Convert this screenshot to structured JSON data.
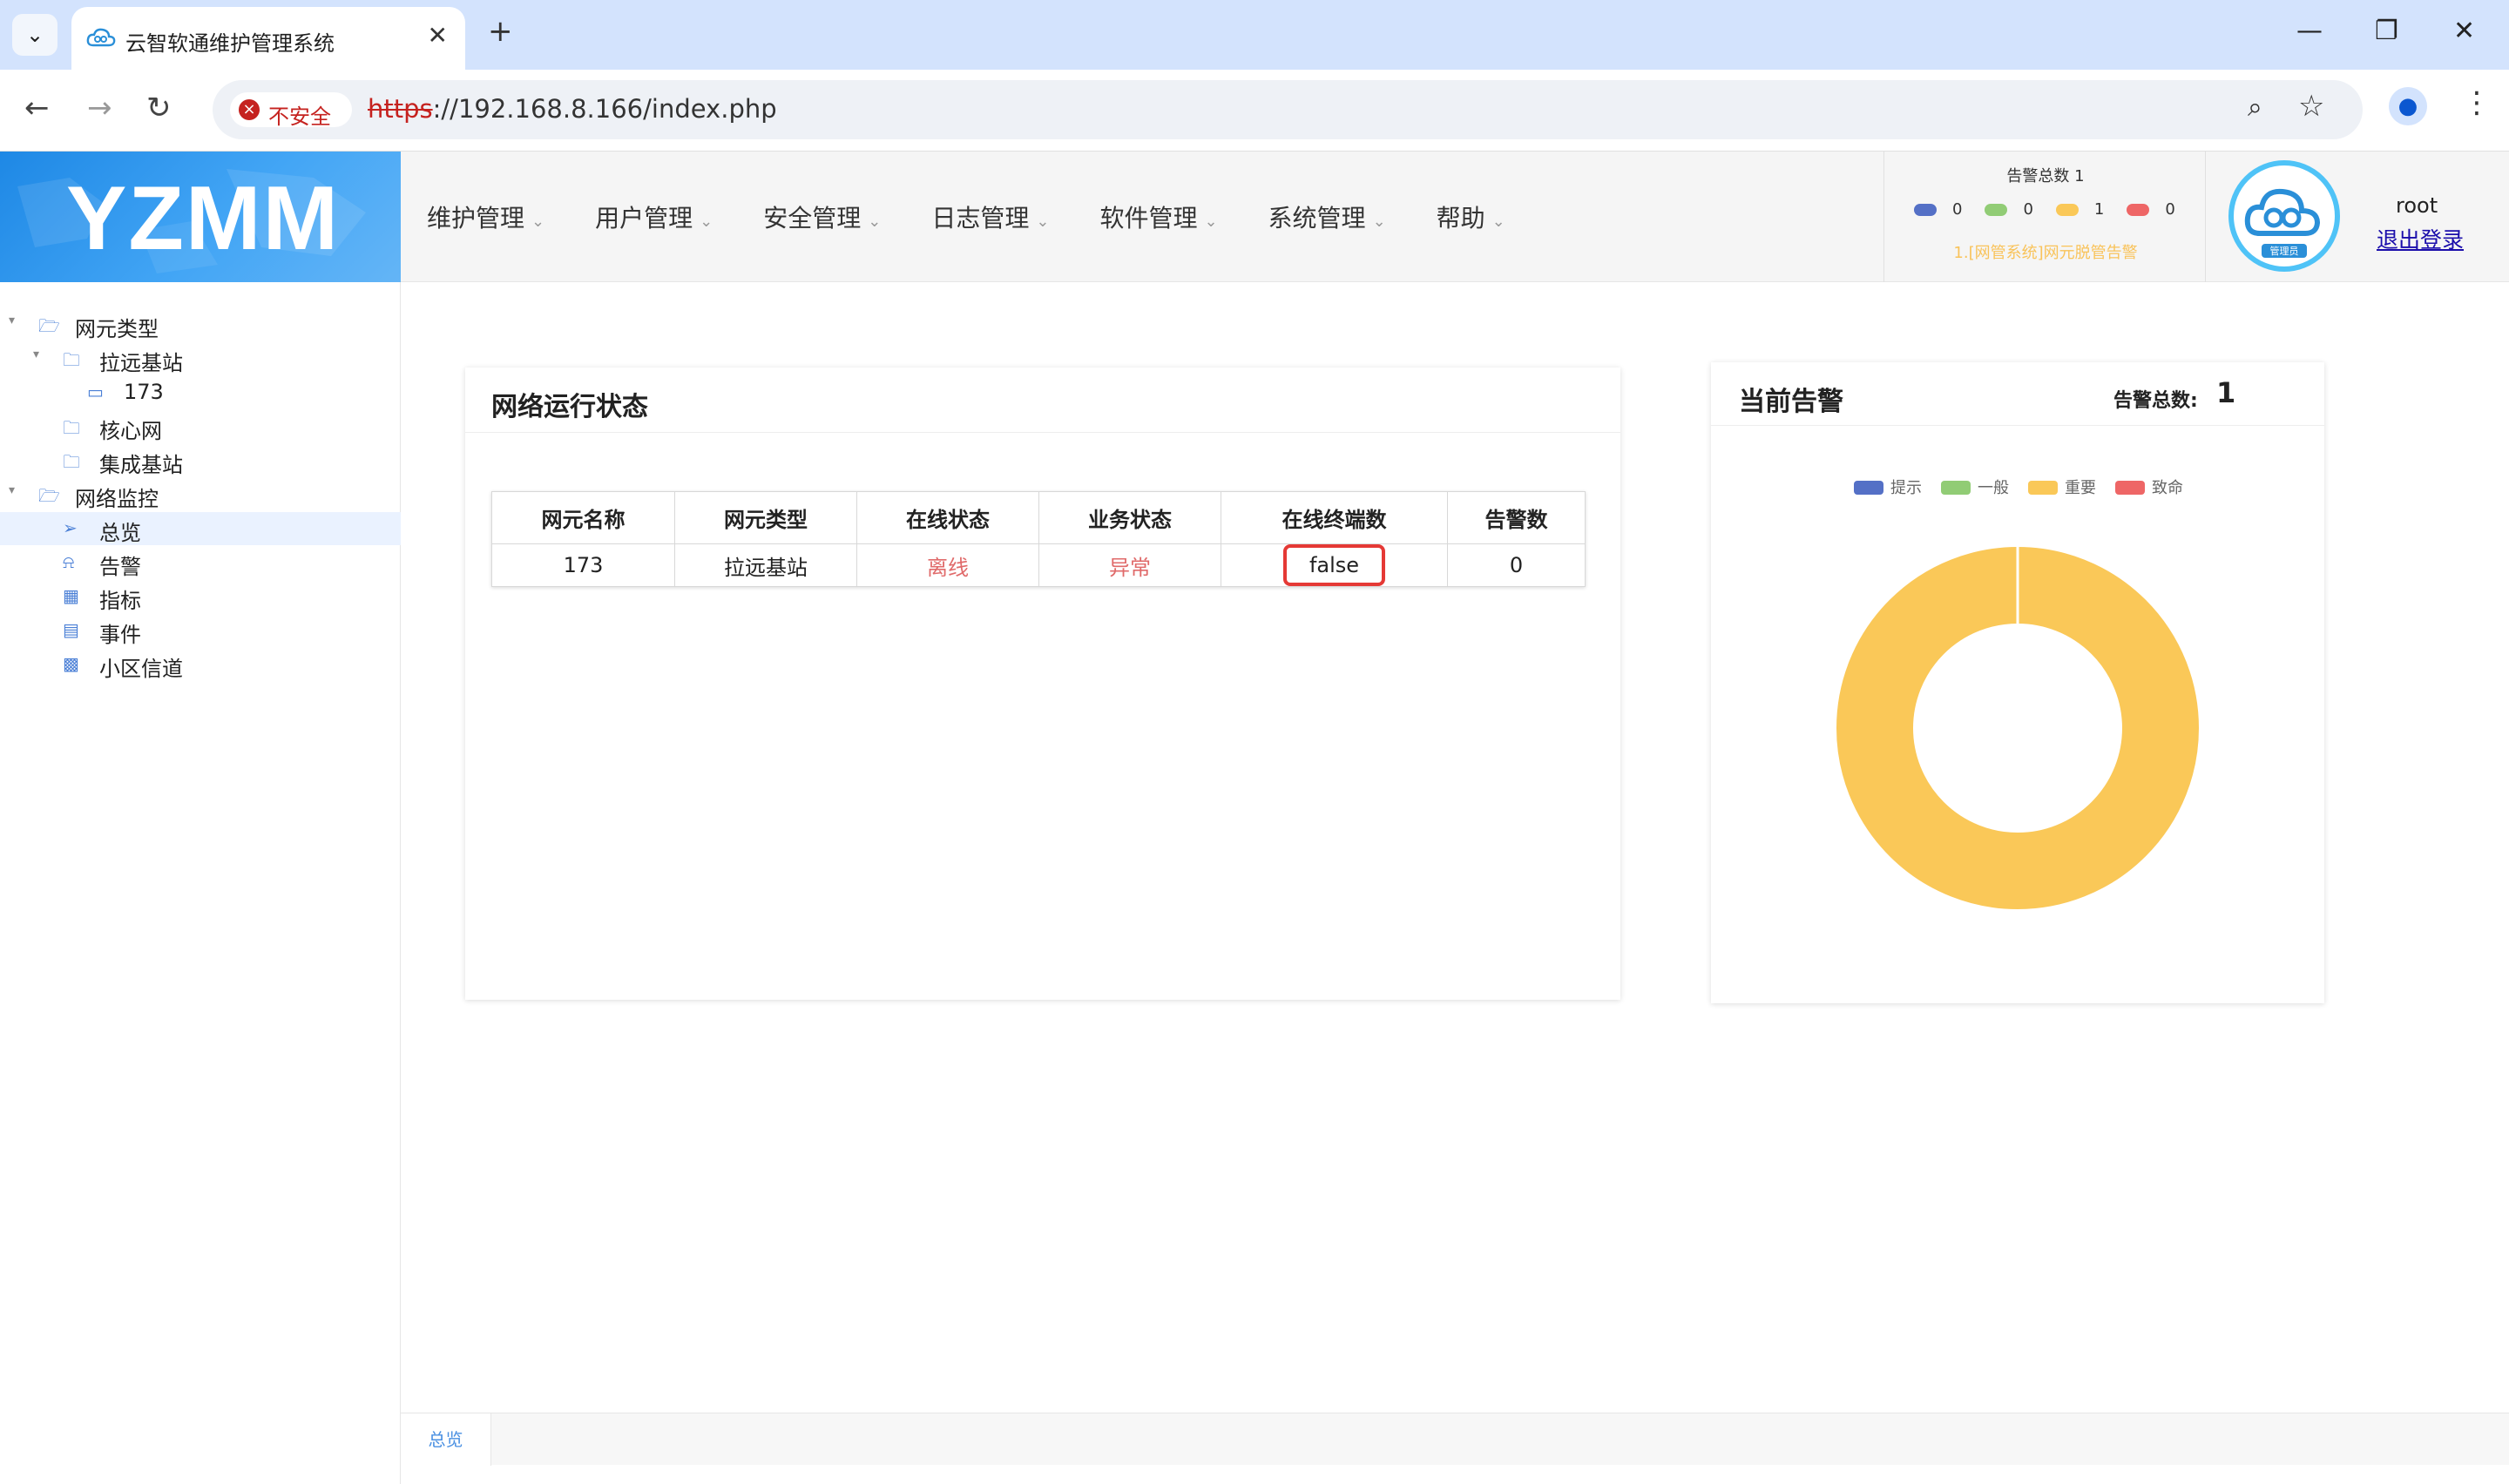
{
  "browser": {
    "tab_title": "云智软通维护管理系统",
    "tab_close": "✕",
    "new_tab": "+",
    "security_label": "不安全",
    "url_scheme": "https",
    "url_rest": "://192.168.8.166/index.php",
    "icons": {
      "tab_dropdown": "chevron-down-icon",
      "back": "arrow-left-icon",
      "forward": "arrow-right-icon",
      "reload": "reload-icon",
      "zoom": "zoom-icon",
      "star": "star-icon",
      "profile": "profile-icon",
      "menu": "kebab-menu-icon"
    }
  },
  "header": {
    "logo_text": "YZMM",
    "menu": [
      "维护管理",
      "用户管理",
      "安全管理",
      "日志管理",
      "软件管理",
      "系统管理",
      "帮助"
    ],
    "alarm_summary": {
      "title": "告警总数 1",
      "levels": [
        {
          "color": "#5470c6",
          "count": "0"
        },
        {
          "color": "#91cc75",
          "count": "0"
        },
        {
          "color": "#fac858",
          "count": "1"
        },
        {
          "color": "#ee6666",
          "count": "0"
        }
      ],
      "latest": "1.[网管系统]网元脱管告警"
    },
    "user": {
      "name": "root",
      "logout": "退出登录",
      "avatar_badge": "管理员"
    }
  },
  "sidebar": {
    "items": [
      {
        "label": "网元类型",
        "icon": "folder-open-icon"
      },
      {
        "label": "拉远基站",
        "icon": "folder-icon"
      },
      {
        "label": "173",
        "icon": "monitor-icon"
      },
      {
        "label": "核心网",
        "icon": "folder-icon"
      },
      {
        "label": "集成基站",
        "icon": "folder-icon"
      },
      {
        "label": "网络监控",
        "icon": "folder-open-icon"
      },
      {
        "label": "总览",
        "icon": "send-icon"
      },
      {
        "label": "告警",
        "icon": "bell-icon"
      },
      {
        "label": "指标",
        "icon": "chart-icon"
      },
      {
        "label": "事件",
        "icon": "document-icon"
      },
      {
        "label": "小区信道",
        "icon": "grid-icon"
      }
    ]
  },
  "network_panel": {
    "title": "网络运行状态",
    "columns": [
      "网元名称",
      "网元类型",
      "在线状态",
      "业务状态",
      "在线终端数",
      "告警数"
    ],
    "rows": [
      {
        "name": "173",
        "type": "拉远基站",
        "online": "离线",
        "service": "异常",
        "terminals": "false",
        "alarms": "0"
      }
    ]
  },
  "alarm_panel": {
    "title": "当前告警",
    "total_label": "告警总数:",
    "total_value": "1"
  },
  "chart_data": {
    "type": "pie",
    "categories": [
      "提示",
      "一般",
      "重要",
      "致命"
    ],
    "values": [
      0,
      0,
      1,
      0
    ],
    "colors": [
      "#5470c6",
      "#91cc75",
      "#fac858",
      "#ee6666"
    ],
    "legend": "top-center"
  },
  "bottom_tabs": [
    "总览"
  ]
}
